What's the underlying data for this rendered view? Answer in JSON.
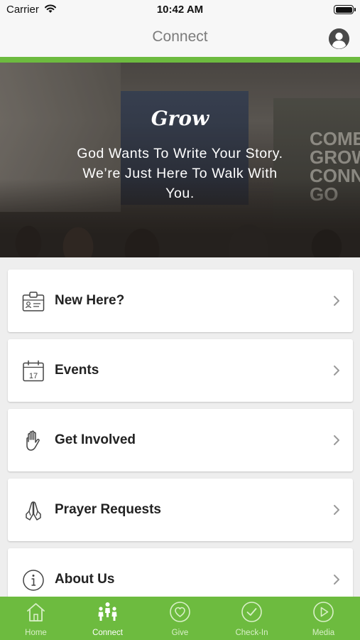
{
  "status_bar": {
    "carrier": "Carrier",
    "time": "10:42 AM"
  },
  "nav": {
    "title": "Connect"
  },
  "hero": {
    "script_heading": "Grow",
    "tagline": "God Wants To Write Your Story. We’re Just Here To Walk With You.",
    "sign_words": [
      "COME",
      "GROW",
      "CONN",
      "GO"
    ]
  },
  "menu": {
    "items": [
      {
        "label": "New Here?",
        "icon": "id-badge-icon"
      },
      {
        "label": "Events",
        "icon": "calendar-icon",
        "icon_text": "17"
      },
      {
        "label": "Get Involved",
        "icon": "raised-hand-icon"
      },
      {
        "label": "Prayer Requests",
        "icon": "praying-hands-icon"
      },
      {
        "label": "About Us",
        "icon": "info-icon"
      }
    ]
  },
  "tabs": [
    {
      "label": "Home",
      "icon": "home-icon"
    },
    {
      "label": "Connect",
      "icon": "people-icon",
      "active": true
    },
    {
      "label": "Give",
      "icon": "heart-circle-icon"
    },
    {
      "label": "Check-In",
      "icon": "check-circle-icon"
    },
    {
      "label": "Media",
      "icon": "play-circle-icon"
    }
  ],
  "colors": {
    "accent": "#6dbb3f",
    "nav_title": "#7b7b7b",
    "background": "#eeeeee"
  }
}
